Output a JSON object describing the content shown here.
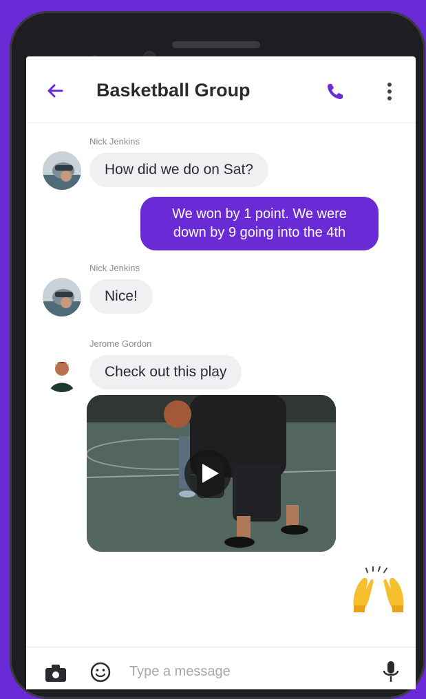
{
  "header": {
    "title": "Basketball Group",
    "back_icon": "arrow-left-icon",
    "call_icon": "phone-icon",
    "more_icon": "more-vertical-icon"
  },
  "messages": [
    {
      "sender": "Nick Jenkins",
      "text": "How did we do on Sat?",
      "direction": "incoming"
    },
    {
      "text": "We won by 1 point. We were down by 9 going into the 4th",
      "line1": "We won by 1 point. We were",
      "line2": "down by 9 going into the 4th",
      "direction": "outgoing"
    },
    {
      "sender": "Nick Jenkins",
      "text": "Nice!",
      "direction": "incoming"
    },
    {
      "sender": "Jerome Gordon",
      "text": "Check out this play",
      "direction": "incoming"
    }
  ],
  "video": {
    "icon": "play-icon"
  },
  "reaction": {
    "icon": "raising-hands-emoji"
  },
  "composer": {
    "placeholder": "Type a message",
    "camera_icon": "camera-icon",
    "emoji_icon": "smile-icon",
    "mic_icon": "microphone-icon"
  },
  "colors": {
    "accent": "#6a2bd6",
    "incoming_bubble": "#f0f0f3",
    "background": "#6a2bd6"
  }
}
